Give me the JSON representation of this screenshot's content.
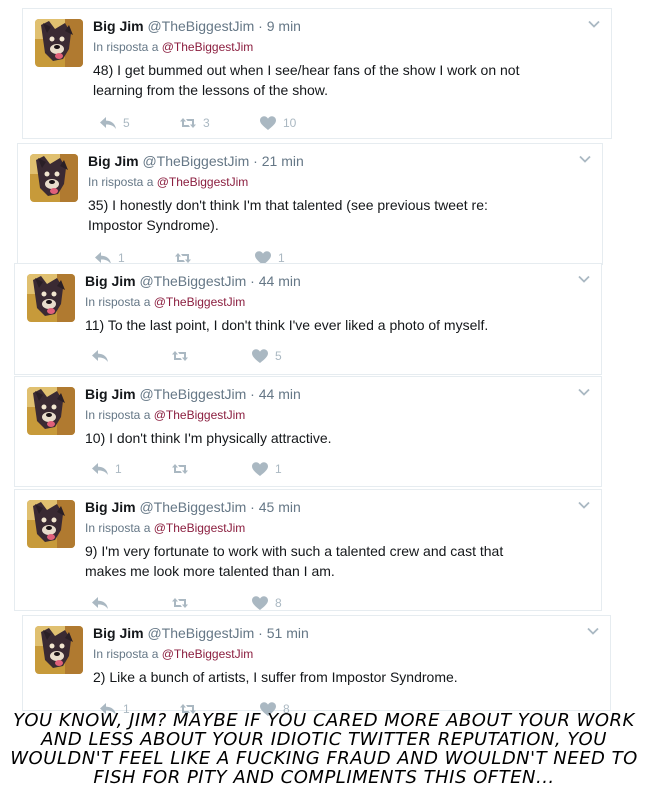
{
  "caption": "YOU KNOW, JIM? MAYBE IF YOU CARED MORE ABOUT YOUR WORK AND LESS ABOUT YOUR IDIOTIC TWITTER REPUTATION, YOU WOULDN'T FEEL LIKE A FUCKING FRAUD AND WOULDN'T NEED TO FISH FOR PITY AND COMPLIMENTS THIS OFTEN...",
  "tweets": [
    {
      "author": "Big Jim",
      "handle": "@TheBiggestJim",
      "dot": "·",
      "time": "9 min",
      "reply_prefix": "In risposta a",
      "reply_to": "@TheBiggestJim",
      "text": "48) I get bummed out when I see/hear fans of the show I work on not learning from the lessons of the show.",
      "replies": "5",
      "retweets": "3",
      "likes": "10"
    },
    {
      "author": "Big Jim",
      "handle": "@TheBiggestJim",
      "dot": "·",
      "time": "21 min",
      "reply_prefix": "In risposta a",
      "reply_to": "@TheBiggestJim",
      "text": "35) I honestly don't think I'm that talented (see previous tweet re: Impostor Syndrome).",
      "replies": "1",
      "retweets": "",
      "likes": "1"
    },
    {
      "author": "Big Jim",
      "handle": "@TheBiggestJim",
      "dot": "·",
      "time": "44 min",
      "reply_prefix": "In risposta a",
      "reply_to": "@TheBiggestJim",
      "text": "11) To the last point, I don't think I've ever liked a photo of myself.",
      "replies": "",
      "retweets": "",
      "likes": "5"
    },
    {
      "author": "Big Jim",
      "handle": "@TheBiggestJim",
      "dot": "·",
      "time": "44 min",
      "reply_prefix": "In risposta a",
      "reply_to": "@TheBiggestJim",
      "text": "10) I don't think I'm physically attractive.",
      "replies": "1",
      "retweets": "",
      "likes": "1"
    },
    {
      "author": "Big Jim",
      "handle": "@TheBiggestJim",
      "dot": "·",
      "time": "45 min",
      "reply_prefix": "In risposta a",
      "reply_to": "@TheBiggestJim",
      "text": "9) I'm very fortunate to work with such a talented crew and cast that makes me look more talented than I am.",
      "replies": "",
      "retweets": "",
      "likes": "8"
    },
    {
      "author": "Big Jim",
      "handle": "@TheBiggestJim",
      "dot": "·",
      "time": "51 min",
      "reply_prefix": "In risposta a",
      "reply_to": "@TheBiggestJim",
      "text": "2) Like a bunch of artists, I suffer from Impostor Syndrome.",
      "replies": "1",
      "retweets": "",
      "likes": "8"
    }
  ]
}
